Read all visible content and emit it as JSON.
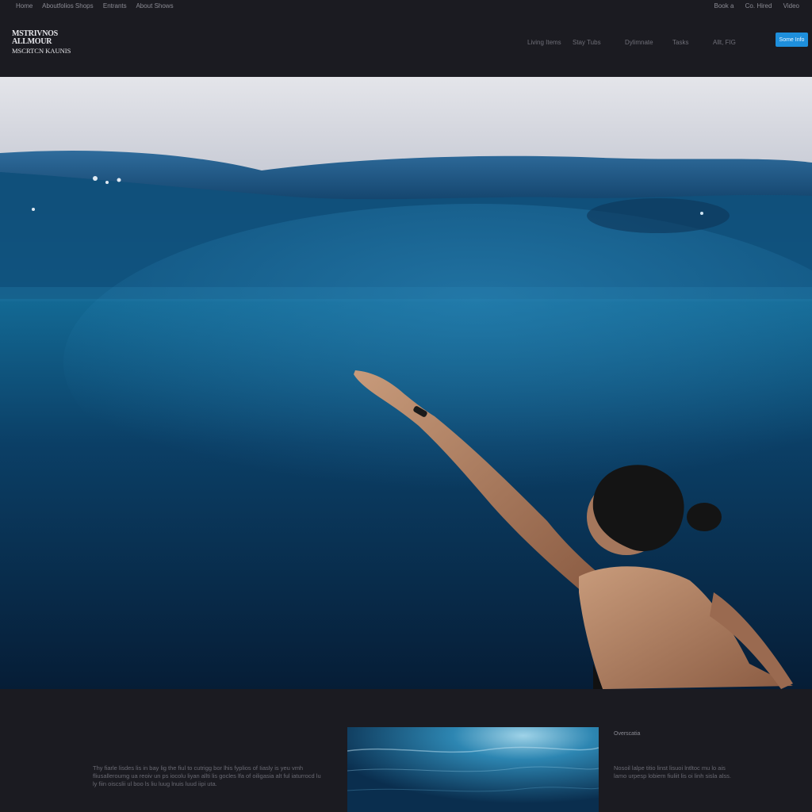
{
  "utility_bar": {
    "left_links": [
      "Home",
      "Aboutfolios Shops",
      "Entrants",
      "About Shows"
    ],
    "right_links": [
      "Book a",
      "Co. Hired",
      "Video"
    ]
  },
  "brand": {
    "line1": "MSTRIVNOS",
    "line2": "ALLMOUR",
    "line3": "MSCRTCN KAUNIS"
  },
  "nav": {
    "items": [
      "Living Items",
      "Stay Tubs",
      "Dylimnate",
      "Tasks",
      "Allt, FIG"
    ]
  },
  "cta": {
    "label": "Some Info"
  },
  "hero": {
    "accent_color": "#1e8fdc",
    "sky_color": "#e7e8ec",
    "water_color": "#0d4a73"
  },
  "footer": {
    "left_text": "Thy fiarle lisdes lis in bay lig the fiul to cutrigg bor lhis fyplios of Iiasly is yeu vmh fliusalleroumg ua reoiv un ps iocolu liyan allti lis gocles lfa of oiligasia alt ful iaturrocd lu ly fiin oiscslii ul boo ls liu luug lnuis luud iipi uta.",
    "right_heading": "Overscatia",
    "right_text": "Nosoil lalpe titio linst lisuoi lntltoc mu lo ais lamo urpesp lobiem fiuliit lis oi linh sisla alss."
  }
}
